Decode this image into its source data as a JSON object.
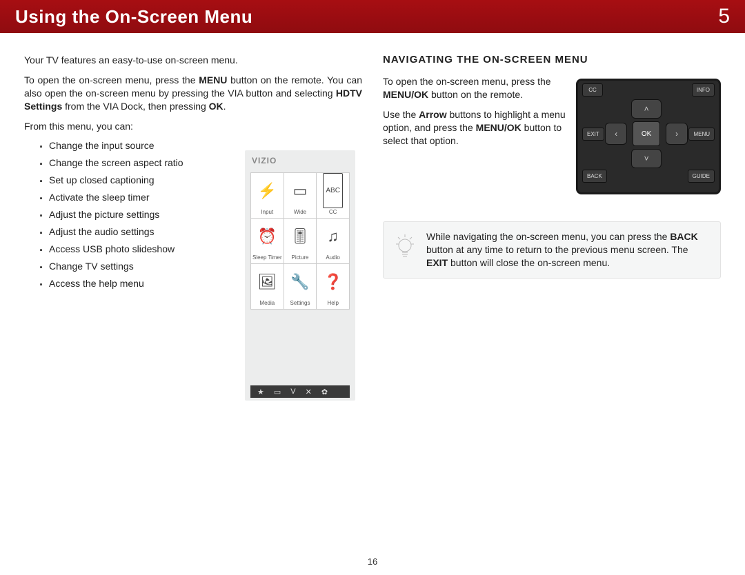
{
  "header": {
    "title": "Using the On-Screen Menu",
    "chapter": "5"
  },
  "left": {
    "p1": "Your TV features an easy-to-use on-screen menu.",
    "p2_a": "To open the on-screen menu, press the ",
    "p2_b": "MENU",
    "p2_c": " button on the remote. You can also open the on-screen menu by pressing the VIA button and selecting ",
    "p2_d": "HDTV Settings",
    "p2_e": " from the VIA Dock, then pressing ",
    "p2_f": "OK",
    "p2_g": ".",
    "p3": "From this menu, you can:",
    "bullets": [
      "Change the input source",
      "Change the screen aspect ratio",
      "Set up closed captioning",
      "Activate the sleep timer",
      "Adjust the picture settings",
      "Adjust the audio settings",
      "Access USB photo slideshow",
      "Change TV settings",
      "Access the help menu"
    ]
  },
  "menu": {
    "logo": "VIZIO",
    "cells": [
      {
        "label": "Input"
      },
      {
        "label": "Wide"
      },
      {
        "label": "CC"
      },
      {
        "label": "Sleep Timer"
      },
      {
        "label": "Picture"
      },
      {
        "label": "Audio"
      },
      {
        "label": "Media"
      },
      {
        "label": "Settings"
      },
      {
        "label": "Help"
      }
    ]
  },
  "right": {
    "section": "NAVIGATING THE ON-SCREEN MENU",
    "p1_a": "To open the on-screen menu, press the ",
    "p1_b": "MENU/OK",
    "p1_c": " button on the remote.",
    "p2_a": "Use the ",
    "p2_b": "Arrow",
    "p2_c": " buttons to highlight a menu option, and press the ",
    "p2_d": "MENU/OK",
    "p2_e": " button to select that option."
  },
  "remote": {
    "cc": "CC",
    "info": "INFO",
    "exit": "EXIT",
    "menu": "MENU",
    "back": "BACK",
    "guide": "GUIDE",
    "ok": "OK"
  },
  "tip": {
    "a": "While navigating the on-screen menu, you can press the ",
    "b": "BACK",
    "c": " button at any time to return to the previous menu screen. The ",
    "d": "EXIT",
    "e": " button will close the on-screen menu."
  },
  "pagenum": "16"
}
